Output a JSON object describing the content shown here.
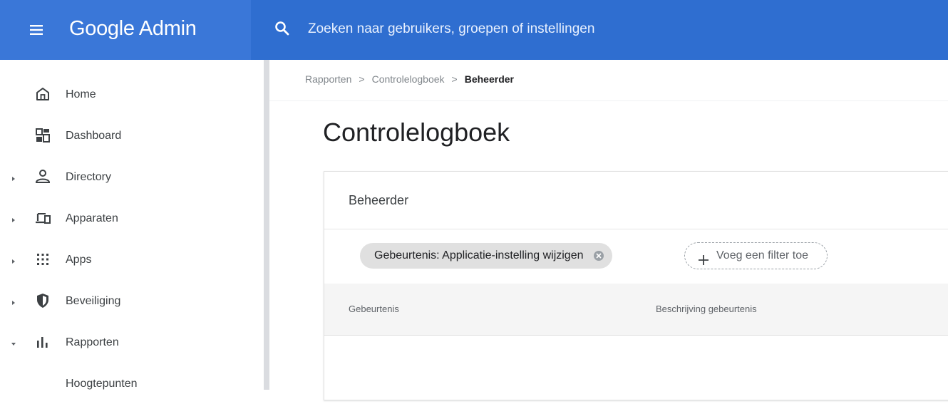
{
  "app": {
    "title": "Google Admin",
    "brand_color": "#2f6ed0",
    "search_placeholder": "Zoeken naar gebruikers, groepen of instellingen",
    "icons": {
      "menu": "hamburger-menu-icon",
      "search": "search-icon"
    }
  },
  "sidebar": {
    "items": [
      {
        "label": "Home",
        "icon": "home-icon",
        "arrow": "none"
      },
      {
        "label": "Dashboard",
        "icon": "dashboard-icon",
        "arrow": "none"
      },
      {
        "label": "Directory",
        "icon": "person-icon",
        "arrow": "collapsed"
      },
      {
        "label": "Apparaten",
        "icon": "devices-icon",
        "arrow": "collapsed"
      },
      {
        "label": "Apps",
        "icon": "apps-grid-icon",
        "arrow": "collapsed"
      },
      {
        "label": "Beveiliging",
        "icon": "shield-icon",
        "arrow": "collapsed"
      },
      {
        "label": "Rapporten",
        "icon": "bar-chart-icon",
        "arrow": "expanded"
      }
    ],
    "sub_items": [
      {
        "label": "Hoogtepunten"
      }
    ]
  },
  "breadcrumb": {
    "items": [
      "Rapporten",
      "Controlelogboek"
    ],
    "current": "Beheerder",
    "separator": ">"
  },
  "page": {
    "title": "Controlelogboek"
  },
  "card": {
    "title": "Beheerder",
    "filter_chip": "Gebeurtenis: Applicatie-instelling wijzigen",
    "add_filter": "Voeg een filter toe",
    "columns": [
      "Gebeurtenis",
      "Beschrijving gebeurtenis"
    ]
  }
}
